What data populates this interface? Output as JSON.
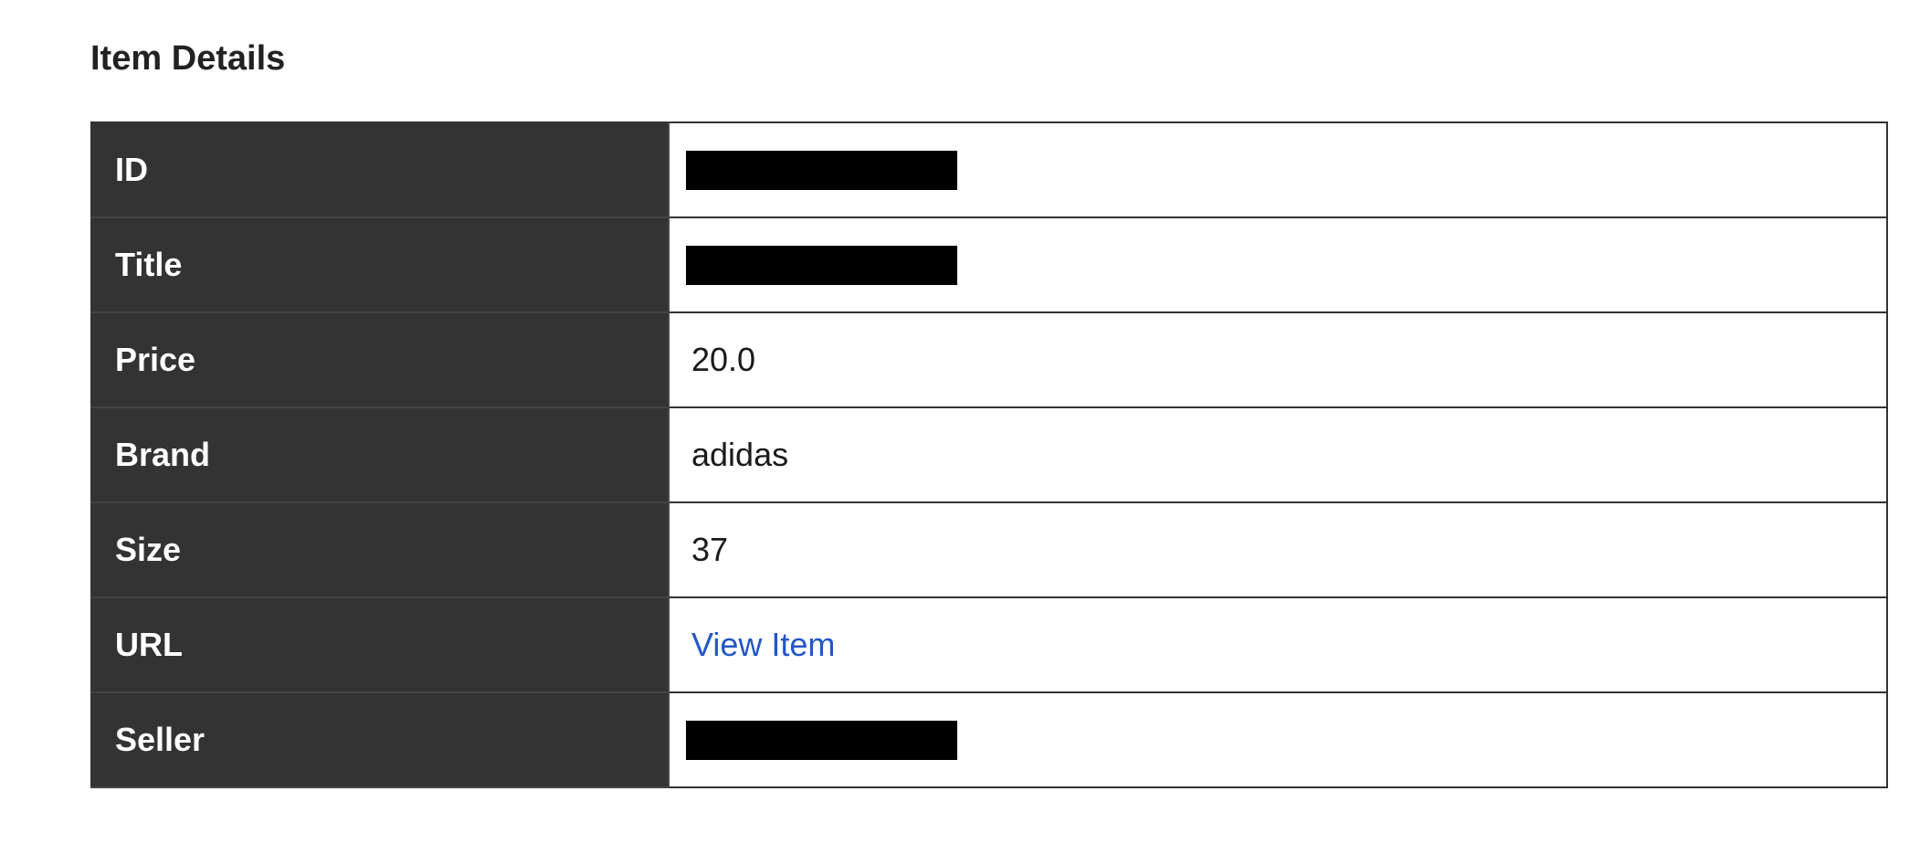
{
  "page": {
    "title": "Item Details"
  },
  "details": {
    "rows": [
      {
        "label": "ID",
        "value": "",
        "redacted": true
      },
      {
        "label": "Title",
        "value": "",
        "redacted": true
      },
      {
        "label": "Price",
        "value": "20.0",
        "redacted": false
      },
      {
        "label": "Brand",
        "value": "adidas",
        "redacted": false
      },
      {
        "label": "Size",
        "value": "37",
        "redacted": false
      },
      {
        "label": "URL",
        "value": "View Item",
        "redacted": false,
        "is_link": true
      },
      {
        "label": "Seller",
        "value": "",
        "redacted": true
      }
    ]
  },
  "colors": {
    "header_bg": "#333333",
    "link": "#2356c7",
    "redaction": "#000000"
  }
}
